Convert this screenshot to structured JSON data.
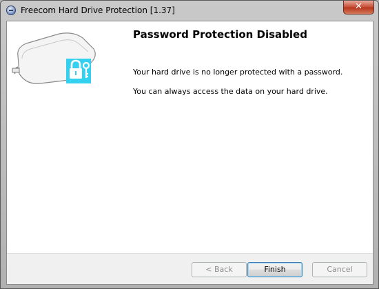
{
  "window": {
    "title": "Freecom Hard Drive Protection [1.37]",
    "close_label": "✕"
  },
  "content": {
    "heading": "Password Protection Disabled",
    "paragraphs": [
      "Your hard drive is no longer protected with a password.",
      "You can always access the data on your hard drive."
    ]
  },
  "buttons": {
    "back": "< Back",
    "finish": "Finish",
    "cancel": "Cancel"
  },
  "colors": {
    "lock_badge": "#33d0f0",
    "close_button": "#c8553d"
  },
  "icons": {
    "app": "shield-icon",
    "illustration": "hard-drive-lock-icon"
  }
}
